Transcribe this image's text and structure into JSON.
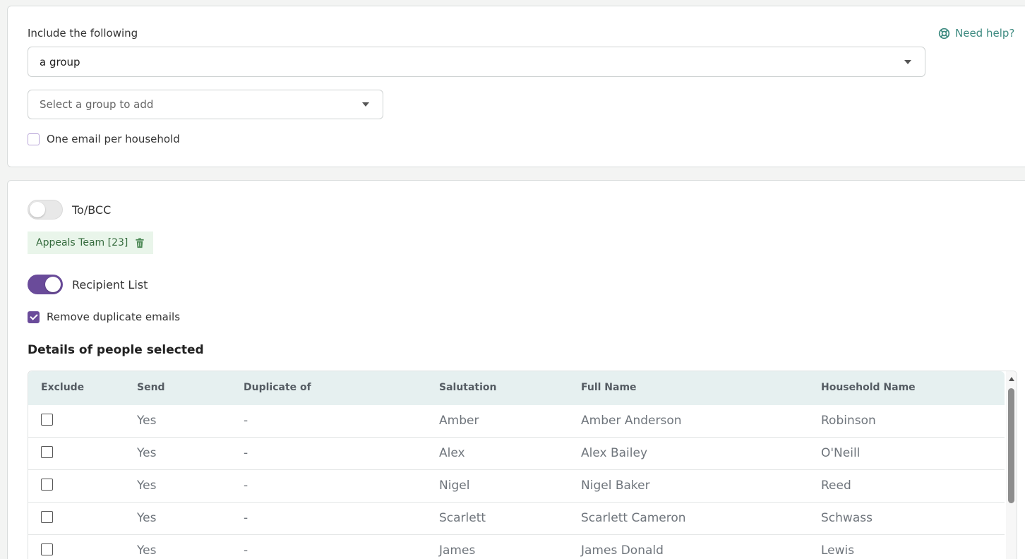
{
  "include": {
    "label": "Include the following",
    "help_label": "Need help?",
    "help_icon": "lifebuoy-icon",
    "type_select_value": "a group",
    "group_select_placeholder": "Select a group to add",
    "one_email_label": "One email per household",
    "one_email_checked": false
  },
  "recipients": {
    "to_bcc_label": "To/BCC",
    "to_bcc_on": false,
    "group_tag": "Appeals Team [23]",
    "tag_icon": "trash-icon",
    "recipient_list_label": "Recipient List",
    "recipient_list_on": true,
    "remove_duplicates_label": "Remove duplicate emails",
    "remove_duplicates_checked": true,
    "details_heading": "Details of people selected"
  },
  "table": {
    "headers": [
      "Exclude",
      "Send",
      "Duplicate of",
      "Salutation",
      "Full Name",
      "Household Name"
    ],
    "rows": [
      {
        "send": "Yes",
        "duplicate": "-",
        "salutation": "Amber",
        "full_name": "Amber Anderson",
        "household": "Robinson"
      },
      {
        "send": "Yes",
        "duplicate": "-",
        "salutation": "Alex",
        "full_name": "Alex Bailey",
        "household": "O'Neill"
      },
      {
        "send": "Yes",
        "duplicate": "-",
        "salutation": "Nigel",
        "full_name": "Nigel Baker",
        "household": "Reed"
      },
      {
        "send": "Yes",
        "duplicate": "-",
        "salutation": "Scarlett",
        "full_name": "Scarlett Cameron",
        "household": "Schwass"
      },
      {
        "send": "Yes",
        "duplicate": "-",
        "salutation": "James",
        "full_name": "James Donald",
        "household": "Lewis"
      }
    ]
  },
  "colors": {
    "accent": "#6a4b9a",
    "help_link": "#3d8a80",
    "tag_bg": "#e9f5ea",
    "table_header_bg": "#e6f0f0"
  }
}
